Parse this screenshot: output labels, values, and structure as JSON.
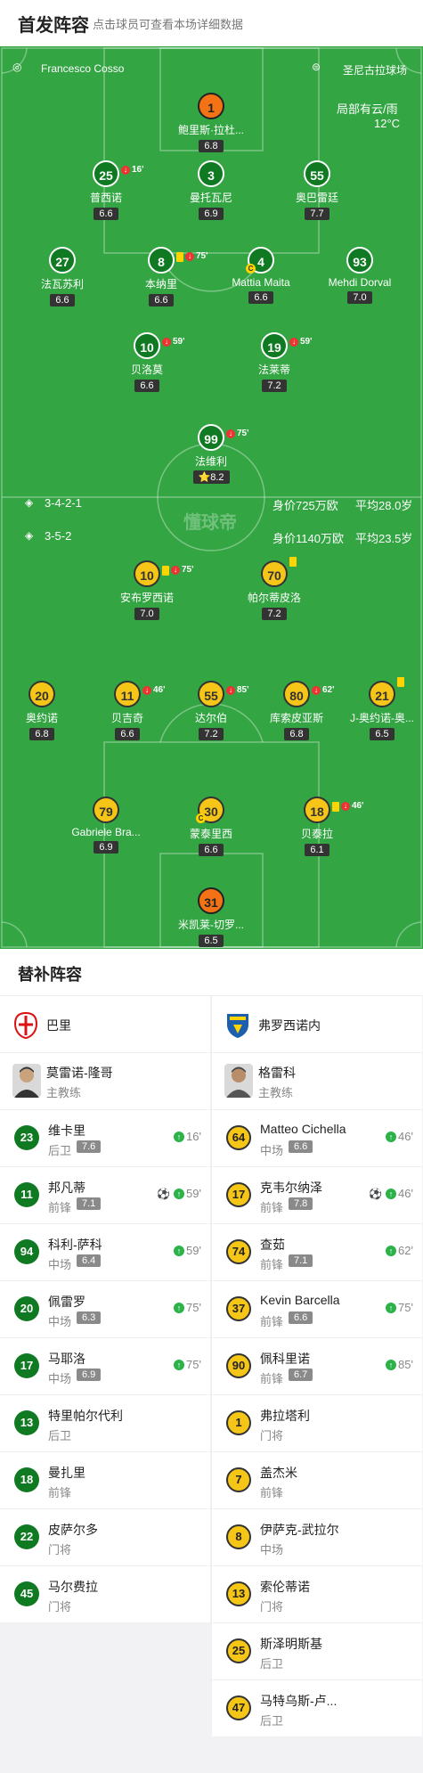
{
  "header": {
    "title": "首发阵容",
    "subtitle": "点击球员可查看本场详细数据"
  },
  "match_info": {
    "referee": "Francesco Cosso",
    "stadium": "圣尼古拉球场",
    "weather": "局部有云/雨",
    "temperature": "12°C",
    "watermark": "懂球帝"
  },
  "home_summary": {
    "formation": "3-4-2-1",
    "value": "身价725万欧",
    "age": "平均28.0岁"
  },
  "away_summary": {
    "formation": "3-5-2",
    "value": "身价1140万欧",
    "age": "平均23.5岁"
  },
  "home_players": [
    {
      "num": "1",
      "name": "鲍里斯·拉杜...",
      "rating": "6.8",
      "gk": true
    },
    {
      "num": "25",
      "name": "普西诺",
      "rating": "6.6",
      "sub": "16'"
    },
    {
      "num": "3",
      "name": "曼托瓦尼",
      "rating": "6.9"
    },
    {
      "num": "55",
      "name": "奥巴雷廷",
      "rating": "7.7"
    },
    {
      "num": "27",
      "name": "法瓦苏利",
      "rating": "6.6"
    },
    {
      "num": "8",
      "name": "本纳里",
      "rating": "6.6",
      "sub": "75'",
      "yellow": true
    },
    {
      "num": "4",
      "name": "Mattia Maita",
      "rating": "6.6",
      "captain": true
    },
    {
      "num": "93",
      "name": "Mehdi Dorval",
      "rating": "7.0"
    },
    {
      "num": "10",
      "name": "贝洛莫",
      "rating": "6.6",
      "sub": "59'"
    },
    {
      "num": "19",
      "name": "法莱蒂",
      "rating": "7.2",
      "sub": "59'"
    },
    {
      "num": "99",
      "name": "法维利",
      "rating": "8.2",
      "sub": "75'"
    }
  ],
  "away_players": [
    {
      "num": "10",
      "name": "安布罗西诺",
      "rating": "7.0",
      "sub": "75'",
      "yellow": true
    },
    {
      "num": "70",
      "name": "帕尔蒂皮洛",
      "rating": "7.2",
      "yellow": true
    },
    {
      "num": "20",
      "name": "奥约诺",
      "rating": "6.8"
    },
    {
      "num": "11",
      "name": "贝吉奇",
      "rating": "6.6",
      "sub": "46'"
    },
    {
      "num": "55",
      "name": "达尔伯",
      "rating": "7.2",
      "sub": "85'"
    },
    {
      "num": "80",
      "name": "库索皮亚斯",
      "rating": "6.8",
      "sub": "62'"
    },
    {
      "num": "21",
      "name": "J-奥约诺-奥...",
      "rating": "6.5",
      "yellow": true
    },
    {
      "num": "79",
      "name": "Gabriele Bra...",
      "rating": "6.9"
    },
    {
      "num": "30",
      "name": "蒙泰里西",
      "rating": "6.6",
      "captain": true
    },
    {
      "num": "18",
      "name": "贝泰拉",
      "rating": "6.1",
      "sub": "46'",
      "yellow": true
    },
    {
      "num": "31",
      "name": "米凯莱-切罗...",
      "rating": "6.5",
      "gk": true
    }
  ],
  "subs_title": "替补阵容",
  "home_team": {
    "name": "巴里",
    "coach": "莫雷诺-隆哥",
    "coach_role": "主教练",
    "crest_color": "#d11"
  },
  "away_team": {
    "name": "弗罗西诺内",
    "coach": "格雷科",
    "coach_role": "主教练",
    "crest_color": "#1c5fae"
  },
  "home_subs": [
    {
      "num": "23",
      "name": "维卡里",
      "pos": "后卫",
      "rating": "7.6",
      "in": "16'"
    },
    {
      "num": "11",
      "name": "邦凡蒂",
      "pos": "前锋",
      "rating": "7.1",
      "in": "59'",
      "goal": true
    },
    {
      "num": "94",
      "name": "科利-萨科",
      "pos": "中场",
      "rating": "6.4",
      "in": "59'"
    },
    {
      "num": "20",
      "name": "佩雷罗",
      "pos": "中场",
      "rating": "6.3",
      "in": "75'"
    },
    {
      "num": "17",
      "name": "马耶洛",
      "pos": "中场",
      "rating": "6.9",
      "in": "75'"
    },
    {
      "num": "13",
      "name": "特里帕尔代利",
      "pos": "后卫"
    },
    {
      "num": "18",
      "name": "曼扎里",
      "pos": "前锋"
    },
    {
      "num": "22",
      "name": "皮萨尔多",
      "pos": "门将"
    },
    {
      "num": "45",
      "name": "马尔费拉",
      "pos": "门将"
    }
  ],
  "away_subs": [
    {
      "num": "64",
      "name": "Matteo Cichella",
      "pos": "中场",
      "rating": "6.6",
      "in": "46'"
    },
    {
      "num": "17",
      "name": "克韦尔纳泽",
      "pos": "前锋",
      "rating": "7.8",
      "in": "46'",
      "goal": true
    },
    {
      "num": "74",
      "name": "查茹",
      "pos": "前锋",
      "rating": "7.1",
      "in": "62'"
    },
    {
      "num": "37",
      "name": "Kevin Barcella",
      "pos": "前锋",
      "rating": "6.6",
      "in": "75'"
    },
    {
      "num": "90",
      "name": "佩科里诺",
      "pos": "前锋",
      "rating": "6.7",
      "in": "85'"
    },
    {
      "num": "1",
      "name": "弗拉塔利",
      "pos": "门将"
    },
    {
      "num": "7",
      "name": "盖杰米",
      "pos": "前锋"
    },
    {
      "num": "8",
      "name": "伊萨克-武拉尔",
      "pos": "中场"
    },
    {
      "num": "13",
      "name": "索伦蒂诺",
      "pos": "门将"
    },
    {
      "num": "25",
      "name": "斯泽明斯基",
      "pos": "后卫"
    },
    {
      "num": "47",
      "name": "马特乌斯-卢...",
      "pos": "后卫"
    }
  ]
}
